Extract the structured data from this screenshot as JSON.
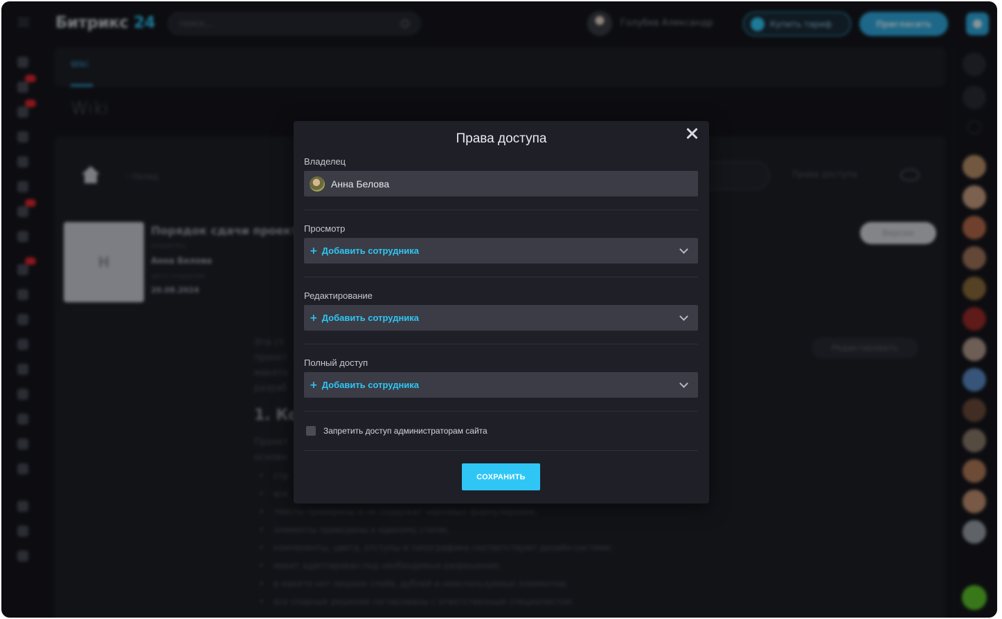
{
  "app": {
    "logo_main": "Битрикс",
    "logo_num": "24",
    "search_placeholder": "поиск...",
    "user_name": "Голубев Александр",
    "buy_label": "Купить тариф",
    "invite_label": "Пригласить"
  },
  "page": {
    "tab_label": "Wiki",
    "heading": "Wiki",
    "back_label": "Назад",
    "rights_label": "Права доступа",
    "version_label": "Версии",
    "edit_label": "Редактировать"
  },
  "document": {
    "thumb_letter": "H",
    "title": "Порядок сдачи проекта",
    "meta_owner_label": "владелец",
    "owner": "Анна Белова",
    "meta_date_label": "дата создания",
    "date": "20.08.2024",
    "section_heading": "1. Ко",
    "intro_lines": [
      "Эта ст",
      "проект",
      "макето",
      "разраб"
    ],
    "para_lines": [
      "Проект",
      "основн"
    ],
    "bullets": [
      "стр",
      "все",
      "тексты проверены и не содержат черновых формулировок;",
      "элементы приведены к единому стилю;",
      "компоненты, цвета, отступы и типографика соответствуют дизайн-системе;",
      "макет адаптирован под необходимые разрешения;",
      "в макете нет лишних слоёв, дублей и неиспользуемых элементов;",
      "все спорные решения согласованы с ответственным специалистом."
    ]
  },
  "modal": {
    "title": "Права доступа",
    "owner_label": "Владелец",
    "owner_name": "Анна Белова",
    "view_label": "Просмотр",
    "edit_label": "Редактирование",
    "full_label": "Полный доступ",
    "add_employee": "Добавить сотрудника",
    "add_plus": "+",
    "restrict_admins": "Запретить доступ администраторам сайта",
    "save": "СОХРАНИТЬ"
  },
  "colors": {
    "accent": "#2fc6f6",
    "background": "#15161c",
    "modal": "#1f2027",
    "field": "#3b3c45",
    "badge": "#e0252e"
  },
  "icons": [
    "menu-icon",
    "search-icon",
    "close-icon",
    "chevron-down-icon",
    "home-icon",
    "eye-icon",
    "gear-icon",
    "phone-icon"
  ]
}
